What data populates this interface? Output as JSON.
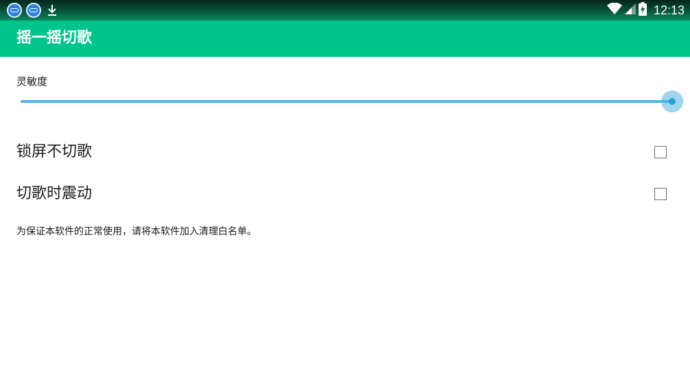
{
  "status_bar": {
    "time": "12:13",
    "icons": [
      "fox-notification-icon",
      "fox-notification-icon",
      "download-icon",
      "wifi-icon",
      "cell-signal-icon",
      "battery-charging-icon"
    ]
  },
  "app_bar": {
    "title": "摇一摇切歌"
  },
  "settings": {
    "sensitivity": {
      "label": "灵敏度",
      "value": 1.0
    },
    "preferences": [
      {
        "title": "锁屏不切歌",
        "checked": false
      },
      {
        "title": "切歌时震动",
        "checked": false
      }
    ],
    "note": "为保证本软件的正常使用，请将本软件加入清理白名单。"
  },
  "colors": {
    "accent": "#00c58a",
    "slider": "#4fb5e2",
    "text": "#1a1a1a"
  }
}
